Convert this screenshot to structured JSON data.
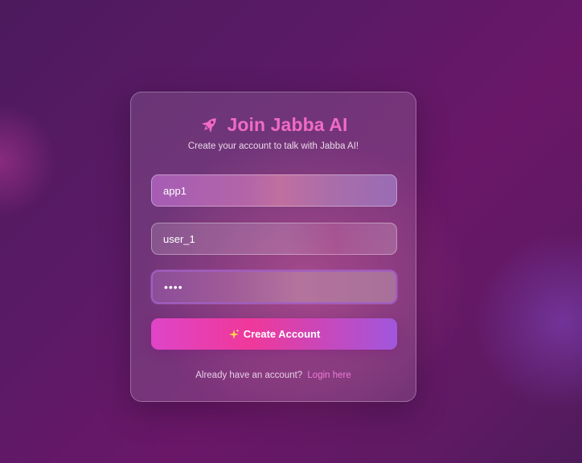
{
  "colors": {
    "accent": "#f06bc4",
    "button_start": "#de45c8",
    "button_end": "#a057de",
    "link": "#ef7ad6"
  },
  "header": {
    "icon": "rocket-icon",
    "title": "Join Jabba AI",
    "subtitle": "Create your account to talk with Jabba AI!"
  },
  "form": {
    "field1_value": "app1",
    "field2_value": "user_1",
    "password_value": "••••",
    "submit_icon": "sparkles-icon",
    "submit_label": "Create Account"
  },
  "footer": {
    "prompt": "Already have an account?",
    "link_label": "Login here"
  }
}
